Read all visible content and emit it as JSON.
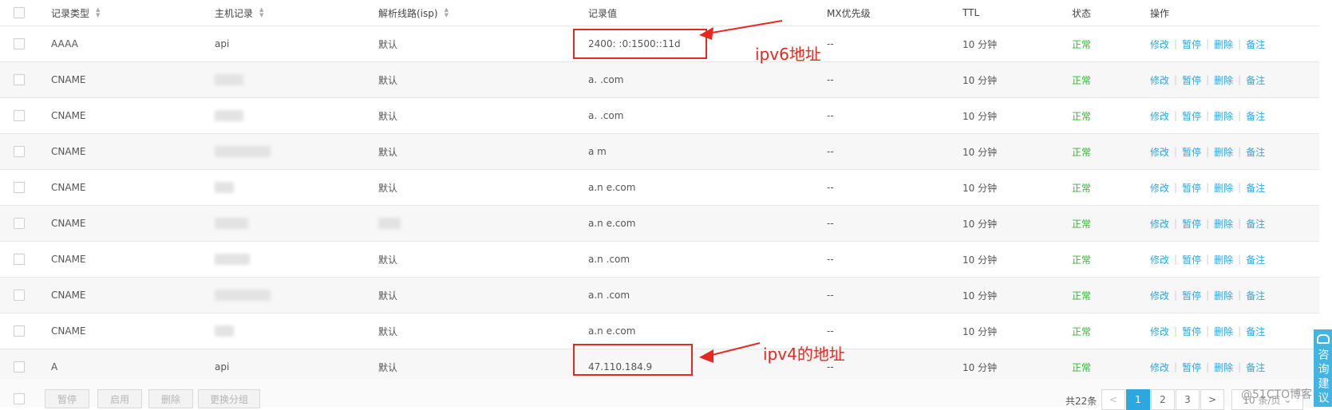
{
  "columns": {
    "type": "记录类型",
    "host": "主机记录",
    "line": "解析线路(isp)",
    "value": "记录值",
    "mx": "MX优先级",
    "ttl": "TTL",
    "status": "状态",
    "ops": "操作"
  },
  "rows": [
    {
      "type": "AAAA",
      "host": "api",
      "line": "默认",
      "value": "2400:    :0:1500::11d",
      "mx": "--",
      "ttl": "10 分钟",
      "status": "正常"
    },
    {
      "type": "CNAME",
      "host": "",
      "line": "默认",
      "value": "a.          .com",
      "mx": "--",
      "ttl": "10 分钟",
      "status": "正常"
    },
    {
      "type": "CNAME",
      "host": "",
      "line": "默认",
      "value": "a.          .com",
      "mx": "--",
      "ttl": "10 分钟",
      "status": "正常"
    },
    {
      "type": "CNAME",
      "host": "",
      "line": "默认",
      "value": "a           m",
      "mx": "--",
      "ttl": "10 分钟",
      "status": "正常"
    },
    {
      "type": "CNAME",
      "host": "",
      "line": "默认",
      "value": "a.n       e.com",
      "mx": "--",
      "ttl": "10 分钟",
      "status": "正常"
    },
    {
      "type": "CNAME",
      "host": "",
      "line": "",
      "value": "a.n       e.com",
      "mx": "--",
      "ttl": "10 分钟",
      "status": "正常"
    },
    {
      "type": "CNAME",
      "host": "",
      "line": "默认",
      "value": "a.n         .com",
      "mx": "--",
      "ttl": "10 分钟",
      "status": "正常"
    },
    {
      "type": "CNAME",
      "host": "",
      "line": "默认",
      "value": "a.n          .com",
      "mx": "--",
      "ttl": "10 分钟",
      "status": "正常"
    },
    {
      "type": "CNAME",
      "host": "",
      "line": "默认",
      "value": "a.n       e.com",
      "mx": "--",
      "ttl": "10 分钟",
      "status": "正常"
    },
    {
      "type": "A",
      "host": "api",
      "line": "默认",
      "value": "47.110.184.9",
      "mx": "--",
      "ttl": "10 分钟",
      "status": "正常"
    }
  ],
  "row_ops": {
    "edit": "修改",
    "pause": "暂停",
    "delete": "删除",
    "note": "备注"
  },
  "annotations": {
    "ipv6": "ipv6地址",
    "ipv4": "ipv4的地址"
  },
  "footer": {
    "pause": "暂停",
    "enable": "启用",
    "delete": "删除",
    "change_group": "更换分组",
    "total": "共22条",
    "prev": "<",
    "next": ">",
    "pages": [
      "1",
      "2",
      "3"
    ],
    "page_size": "10 条/页"
  },
  "side_tab": "咨询建议",
  "watermark": "@51CTO博客",
  "colors": {
    "accent": "#2ca7e0",
    "status_ok": "#2eb82e",
    "annotation": "#e8281e"
  }
}
